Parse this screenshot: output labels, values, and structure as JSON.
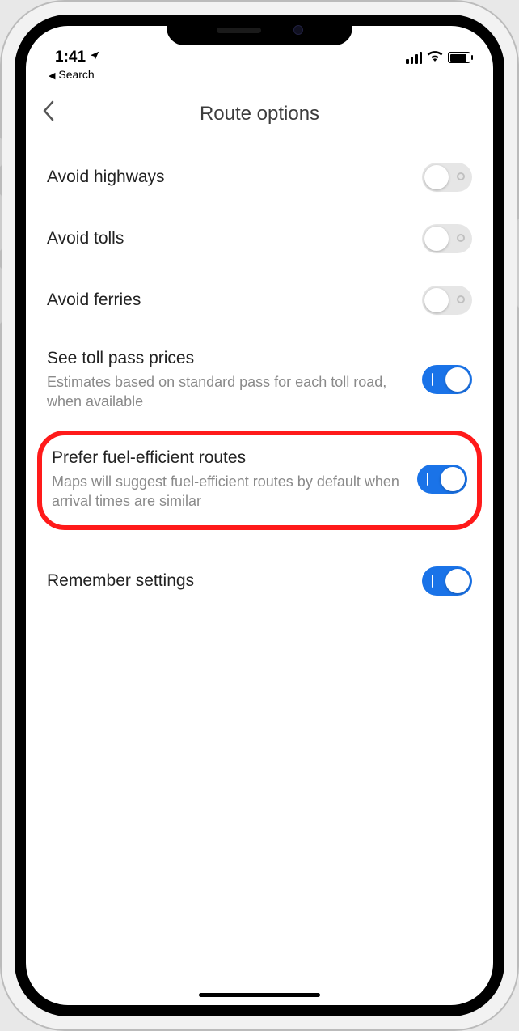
{
  "statusbar": {
    "time": "1:41",
    "back_app": "Search"
  },
  "header": {
    "title": "Route options"
  },
  "options": {
    "avoid_highways": {
      "label": "Avoid highways",
      "on": false
    },
    "avoid_tolls": {
      "label": "Avoid tolls",
      "on": false
    },
    "avoid_ferries": {
      "label": "Avoid ferries",
      "on": false
    },
    "toll_prices": {
      "label": "See toll pass prices",
      "sub": "Estimates based on standard pass for each toll road, when available",
      "on": true
    },
    "fuel_efficient": {
      "label": "Prefer fuel-efficient routes",
      "sub": "Maps will suggest fuel-efficient routes by default when arrival times are similar",
      "on": true
    },
    "remember": {
      "label": "Remember settings",
      "on": true
    }
  },
  "colors": {
    "accent": "#1a73e8",
    "highlight": "#ff1a1a"
  }
}
